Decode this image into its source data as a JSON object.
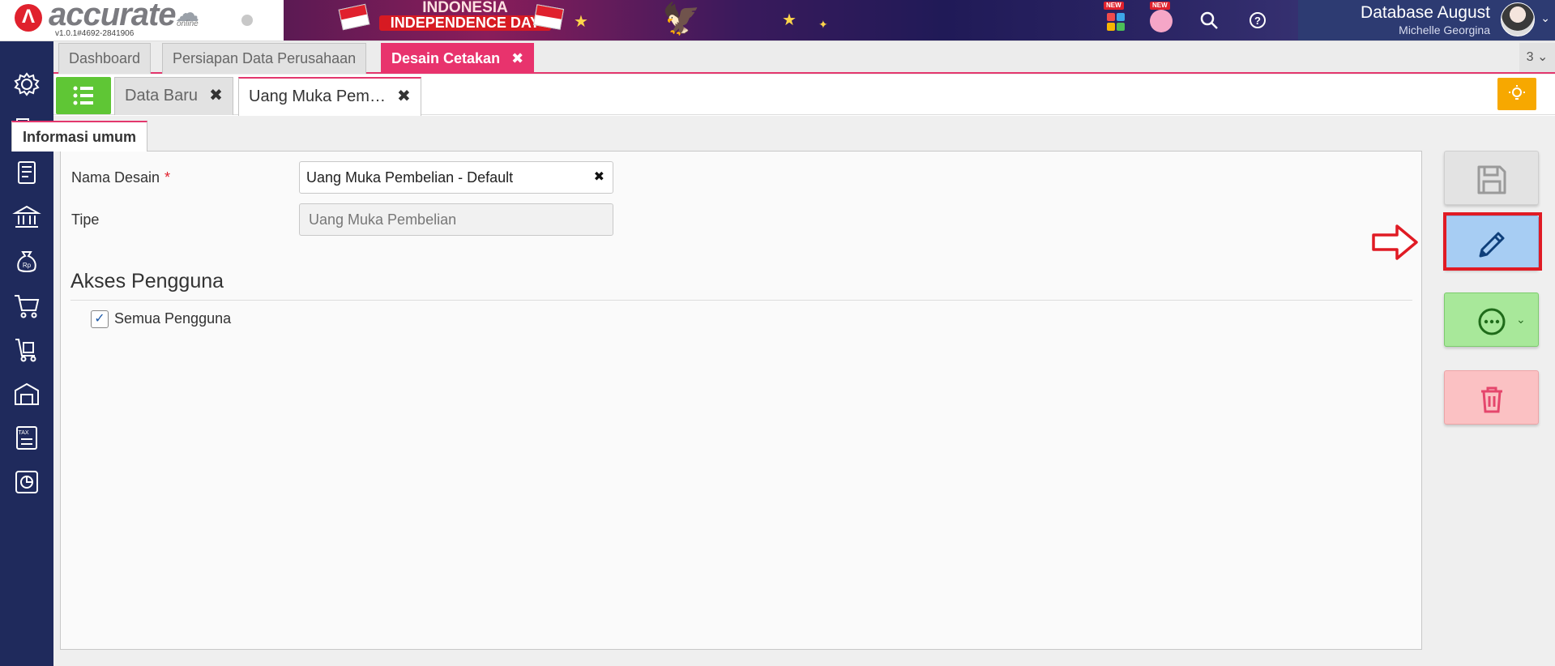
{
  "app": {
    "logo_text": "accurate",
    "logo_sub": "online",
    "version": "v1.0.1#4692-2841906"
  },
  "banner": {
    "line1": "INDONESIA",
    "line2": "INDEPENDENCE DAY"
  },
  "header": {
    "new_badge": "NEW",
    "database": "Database August",
    "user": "Michelle Georgina"
  },
  "main_tabs": [
    {
      "label": "Dashboard"
    },
    {
      "label": "Persiapan Data Perusahaan"
    },
    {
      "label": "Desain Cetakan",
      "active": true,
      "close": "✖"
    }
  ],
  "tab_count": "3 ⌄",
  "sub_tabs": [
    {
      "label": "Data Baru",
      "close": "✖"
    },
    {
      "label": "Uang Muka Pem…",
      "active": true,
      "close": "✖"
    }
  ],
  "form": {
    "tab_label": "Informasi umum",
    "nama_desain_label": "Nama Desain",
    "required_mark": "*",
    "nama_desain_value": "Uang Muka Pembelian - Default",
    "clear_mark": "✖",
    "tipe_label": "Tipe",
    "tipe_value": "Uang Muka Pembelian",
    "akses_title": "Akses Pengguna",
    "semua_label": "Semua Pengguna",
    "semua_checked": true,
    "check_mark": "✓"
  },
  "colors": {
    "sidebar": "#1f2a5c",
    "accent": "#e8336d",
    "list_button": "#5fc635",
    "tip_button": "#f7a800",
    "edit_button": "#a7cdf3",
    "more_button": "#a8e89a",
    "delete_button": "#fbc1c3",
    "highlight": "#e01b24"
  }
}
